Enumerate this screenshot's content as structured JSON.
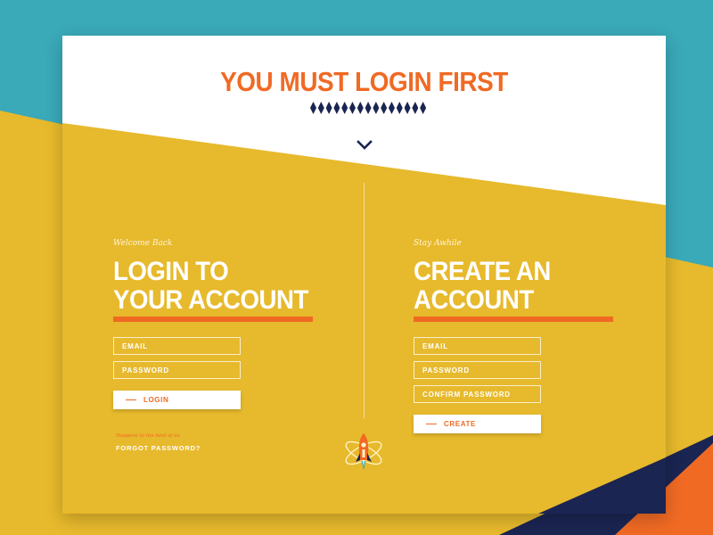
{
  "header": {
    "title": "YOU MUST LOGIN FIRST"
  },
  "login": {
    "eyebrow": "Welcome Back",
    "heading_line1": "LOGIN TO",
    "heading_line2": "YOUR ACCOUNT",
    "email_placeholder": "EMAIL",
    "password_placeholder": "PASSWORD",
    "button_label": "LOGIN",
    "tagline": "Happens to the best of us",
    "forgot_label": "FORGOT PASSWORD?"
  },
  "create": {
    "eyebrow": "Stay Awhile",
    "heading_line1": "CREATE AN",
    "heading_line2": "ACCOUNT",
    "email_placeholder": "EMAIL",
    "password_placeholder": "PASSWORD",
    "confirm_placeholder": "CONFIRM PASSWORD",
    "button_label": "CREATE"
  },
  "icons": {
    "scroll_indicator": "chevron-down-icon",
    "mascot": "rocket-icon",
    "decoration": "diamond-pattern"
  },
  "colors": {
    "teal": "#3aa9b8",
    "mustard": "#e7b92c",
    "orange": "#f06a24",
    "navy": "#1b2552",
    "white": "#ffffff"
  }
}
